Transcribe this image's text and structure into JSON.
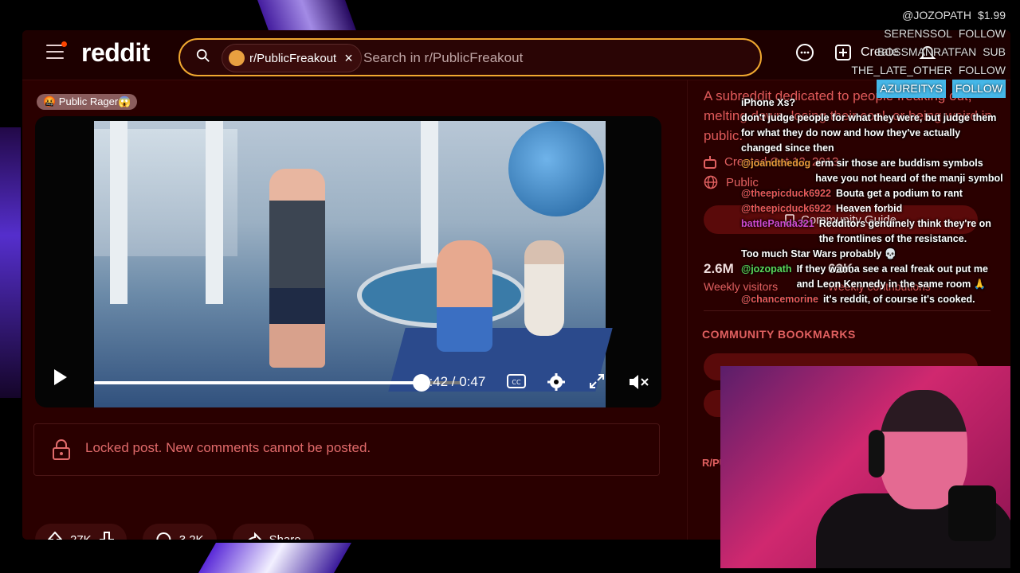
{
  "header": {
    "logo": "reddit",
    "subreddit_chip": "r/PublicFreakout",
    "search_placeholder": "Search in r/PublicFreakout",
    "create_label": "Create"
  },
  "post": {
    "flair": "🤬 Public Rager😱",
    "video": {
      "time_label": "0:42 / 0:47",
      "progress_fraction": 0.894
    },
    "locked_text": "Locked post. New comments cannot be posted.",
    "upvotes": "27K",
    "comments": "3.2K",
    "share_label": "Share"
  },
  "sidebar": {
    "about": "A subreddit dedicated to people freaking out, melting down, losing their cool, or being weird in public.",
    "created": "Created Oct 12, 2013",
    "visibility": "Public",
    "community_guide": "Community Guide",
    "weekly_visitors_value": "2.6M",
    "weekly_visitors_label": "Weekly visitors",
    "weekly_contrib_value": "62K",
    "weekly_contrib_label": "Weekly contributions",
    "bookmarks_title": "COMMUNITY BOOKMARKS",
    "rules_title": "R/PU"
  },
  "stream_alerts": [
    {
      "user": "@JOZOPATH",
      "action": "$1.99"
    },
    {
      "user": "SERENSSOL",
      "action": "FOLLOW"
    },
    {
      "user": "BOSSMANRATFAN",
      "action": "SUB"
    },
    {
      "user": "THE_LATE_OTHER",
      "action": "FOLLOW"
    },
    {
      "user": "AZUREITYS",
      "action": "FOLLOW"
    }
  ],
  "chat": [
    {
      "user": "",
      "text": "iPhone Xs?",
      "color": "#ffffff"
    },
    {
      "user": "",
      "text": "don't judge people for what they were, but judge them for what they do now and how they've actually changed since then",
      "color": "#ffffff"
    },
    {
      "user": "@joandthedog",
      "text": "erm sir those are buddism symbols have you not heard of the manji symbol",
      "color": "#e89a3a"
    },
    {
      "user": "@theepicduck6922",
      "text": "Bouta get a podium to rant",
      "color": "#e85a5a"
    },
    {
      "user": "@theepicduck6922",
      "text": "Heaven forbid",
      "color": "#e85a5a"
    },
    {
      "user": "battlePanda321",
      "text": "Redditors genuinely think they're on the frontlines of the resistance.",
      "color": "#d04ad0"
    },
    {
      "user": "",
      "text": "Too much Star Wars probably 💀",
      "color": "#ffffff"
    },
    {
      "user": "@jozopath",
      "text": "If they wanna see a real freak out put me and Leon Kennedy in the same room 🙏",
      "color": "#5ad85a"
    },
    {
      "user": "@chancemorine",
      "text": "it's reddit, of course it's cooked.",
      "color": "#e85a5a"
    }
  ]
}
